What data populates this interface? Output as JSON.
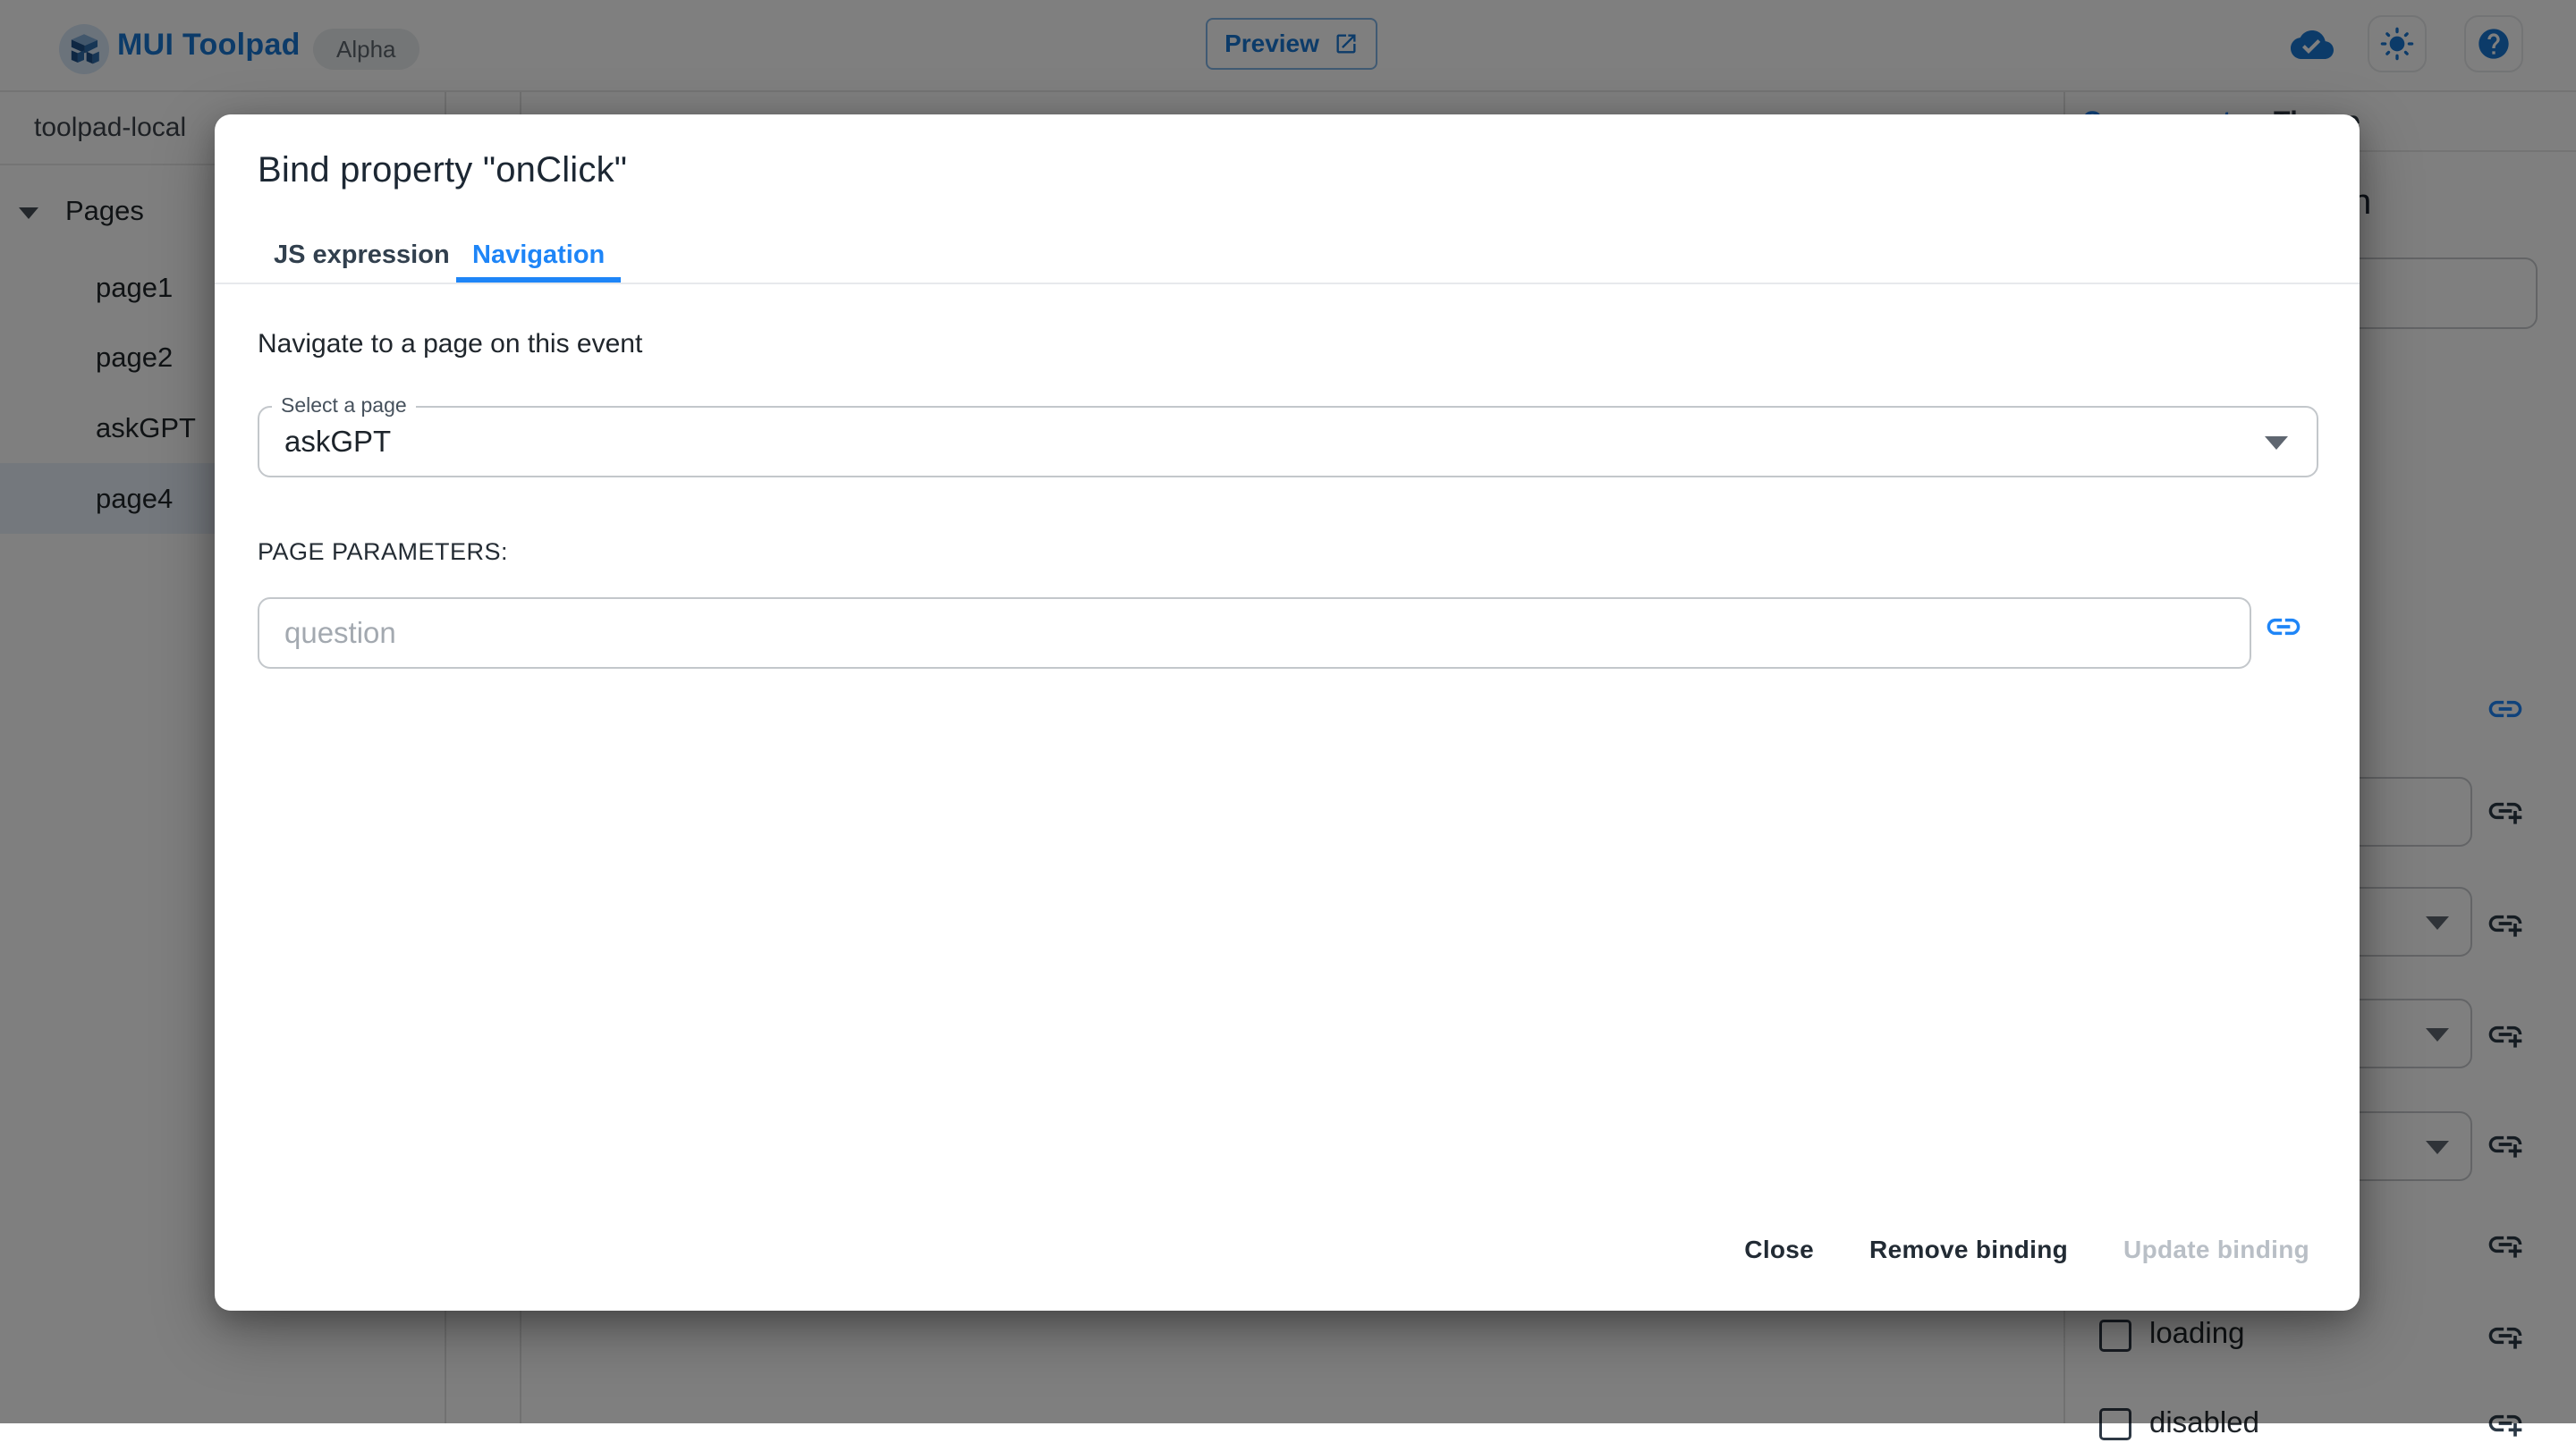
{
  "header": {
    "brand": "MUI Toolpad",
    "badge": "Alpha",
    "preview_label": "Preview"
  },
  "explorer": {
    "workspace": "toolpad-local",
    "tree_root": "Pages",
    "pages": [
      {
        "name": "page1"
      },
      {
        "name": "page2"
      },
      {
        "name": "askGPT"
      },
      {
        "name": "page4"
      }
    ],
    "selected_page": "page4"
  },
  "inspector": {
    "tabs": [
      {
        "label": "Component"
      },
      {
        "label": "Theme"
      }
    ],
    "active_tab": "Component",
    "component_name": "button",
    "checkbox_props": [
      {
        "name": "loading",
        "checked": false
      },
      {
        "name": "disabled",
        "checked": false
      }
    ]
  },
  "dialog": {
    "title": "Bind property \"onClick\"",
    "tabs": [
      {
        "label": "JS expression"
      },
      {
        "label": "Navigation"
      }
    ],
    "active_tab": "Navigation",
    "description": "Navigate to a page on this event",
    "page_select": {
      "label": "Select a page",
      "value": "askGPT"
    },
    "params_heading": "PAGE PARAMETERS:",
    "param_input": {
      "placeholder": "question",
      "value": ""
    },
    "actions": {
      "close": "Close",
      "remove": "Remove binding",
      "update": "Update binding"
    }
  },
  "colors": {
    "accent_blue": "#1e85f7",
    "brand_blue": "#1976d2",
    "text_primary": "#1f262d",
    "disabled_text": "#b9bfc6",
    "selected_row": "#e8f0fa"
  }
}
